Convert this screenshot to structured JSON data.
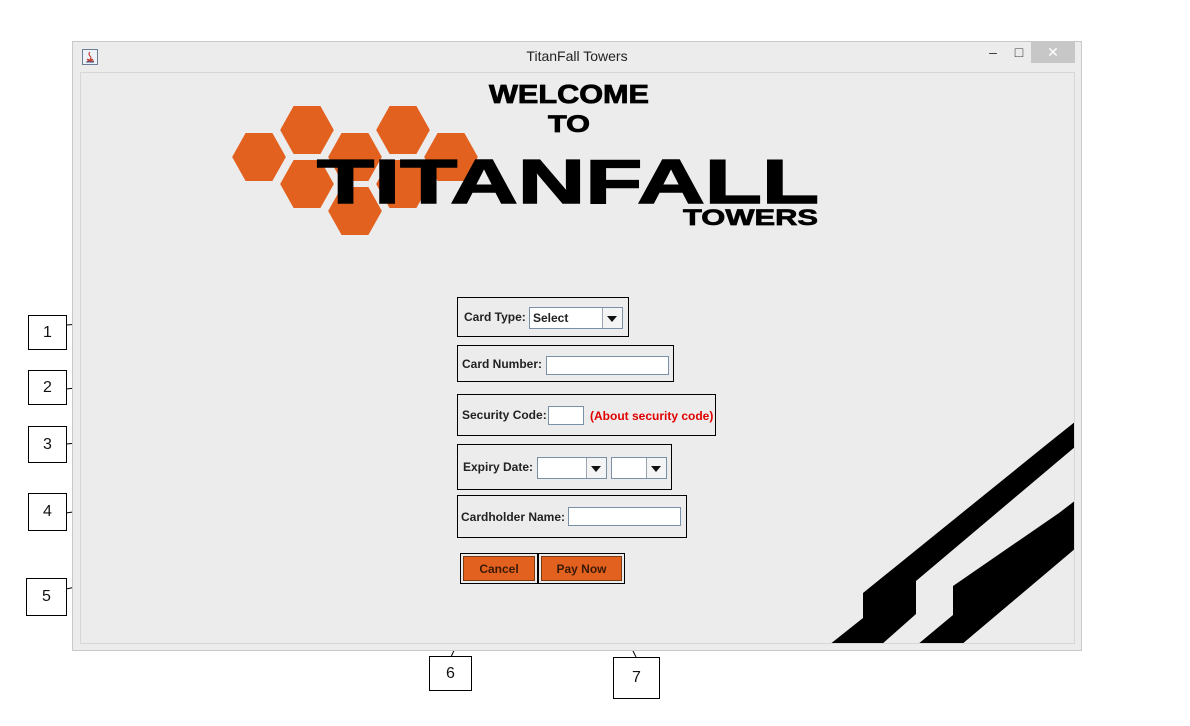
{
  "window": {
    "title": "TitanFall Towers",
    "minimize_glyph": "–",
    "maximize_glyph": "□",
    "close_glyph": "✕"
  },
  "banner": {
    "welcome_line1": "WELCOME",
    "welcome_line2": "TO",
    "brand": "TITANFALL",
    "sub_brand": "TOWERS",
    "accent_color": "#e2611f"
  },
  "form": {
    "card_type_label": "Card Type:",
    "card_type_selected": "Select",
    "card_number_label": "Card Number:",
    "card_number_value": "",
    "security_code_label": "Security Code:",
    "security_code_value": "",
    "about_security_link": "(About security code)",
    "expiry_date_label": "Expiry Date:",
    "expiry_month_selected": "",
    "expiry_year_selected": "",
    "cardholder_name_label": "Cardholder Name:",
    "cardholder_name_value": "",
    "cancel_label": "Cancel",
    "pay_now_label": "Pay Now"
  },
  "callouts": [
    "1",
    "2",
    "3",
    "4",
    "5",
    "6",
    "7"
  ]
}
